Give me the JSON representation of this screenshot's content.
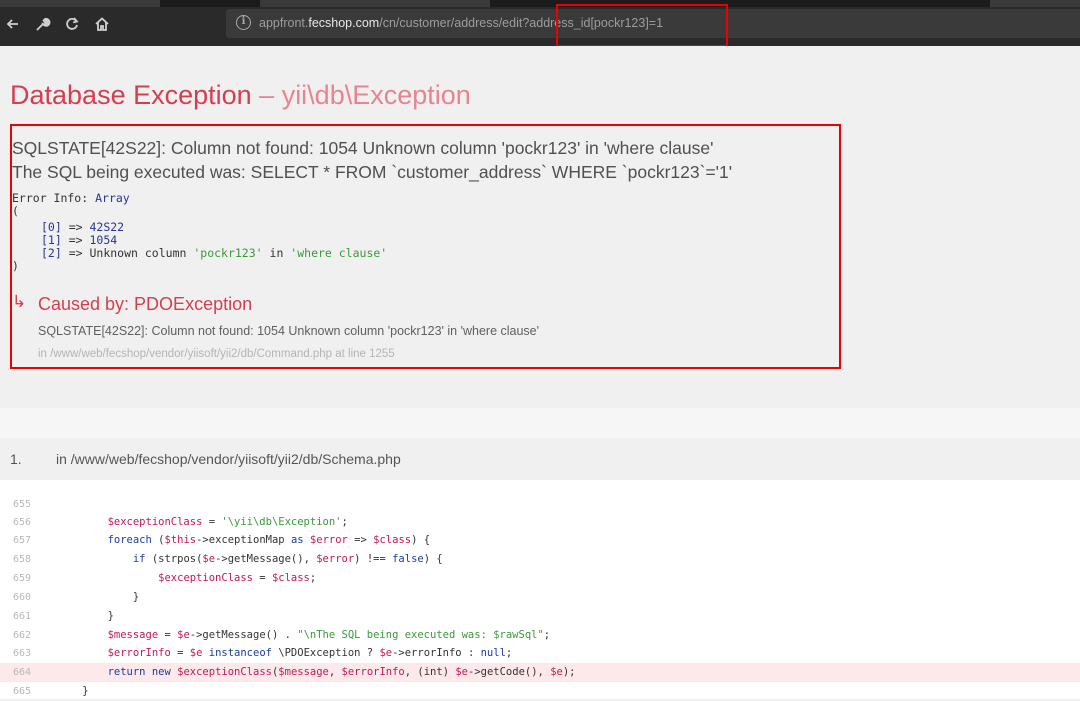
{
  "browser": {
    "url_host_prefix": "appfront.",
    "url_host_main": "fecshop.com",
    "url_path": "/cn/customer/address/edit?address_id[pockr123]=1",
    "icons": [
      "back-arrow-icon",
      "wrench-icon",
      "reload-icon",
      "home-icon",
      "info-icon"
    ]
  },
  "exception": {
    "title": "Database Exception",
    "title_separator": " – ",
    "title_class": "yii\\db\\Exception",
    "message_line1": "SQLSTATE[42S22]: Column not found: 1054 Unknown column 'pockr123' in 'where clause'",
    "message_line2": "The SQL being executed was: SELECT * FROM `customer_address` WHERE `pockr123`='1'",
    "error_info": {
      "label": "Error Info: ",
      "type": "Array",
      "open": "(",
      "close": ")",
      "rows": [
        {
          "key": "[0]",
          "arrow": " => ",
          "value": "42S22"
        },
        {
          "key": "[1]",
          "arrow": " => ",
          "value": "1054"
        },
        {
          "key": "[2]",
          "arrow": " => ",
          "value_pre": "Unknown column ",
          "value_str1": "'pockr123'",
          "value_mid": " in ",
          "value_str2": "'where clause'"
        }
      ]
    },
    "caused_by": {
      "label": "Caused by: PDOException",
      "message": "SQLSTATE[42S22]: Column not found: 1054 Unknown column 'pockr123' in 'where clause'",
      "location": "in /www/web/fecshop/vendor/yiisoft/yii2/db/Command.php at line 1255"
    }
  },
  "callstack": {
    "number": "1.",
    "file": "in /www/web/fecshop/vendor/yiisoft/yii2/db/Schema.php",
    "lines": [
      {
        "n": "655",
        "html_key": "l655"
      },
      {
        "n": "656",
        "html_key": "l656"
      },
      {
        "n": "657",
        "html_key": "l657"
      },
      {
        "n": "658",
        "html_key": "l658"
      },
      {
        "n": "659",
        "html_key": "l659"
      },
      {
        "n": "660",
        "html_key": "l660"
      },
      {
        "n": "661",
        "html_key": "l661"
      },
      {
        "n": "662",
        "html_key": "l662"
      },
      {
        "n": "663",
        "html_key": "l663"
      },
      {
        "n": "664",
        "html_key": "l664",
        "error": true
      },
      {
        "n": "665",
        "html_key": "l665"
      }
    ],
    "code": {
      "l656_var": "$exceptionClass",
      "l656_str": "'\\yii\\db\\Exception'",
      "l657_kw": "foreach",
      "l657_var1": "$this",
      "l657_prop": "->exceptionMap ",
      "l657_as": "as",
      "l657_var2": "$error",
      "l657_var3": "$class",
      "l658_kw": "if",
      "l658_fn": " (strpos(",
      "l658_var1": "$e",
      "l658_mid": "->getMessage(), ",
      "l658_var2": "$error",
      "l658_end": ") !== ",
      "l658_false": "false",
      "l658_close": ") {",
      "l659_var1": "$exceptionClass",
      "l659_var2": "$class",
      "l662_var1": "$message",
      "l662_var2": "$e",
      "l662_mid": "->getMessage() . ",
      "l662_str": "\"\\nThe SQL being executed was: $rawSql\"",
      "l663_var1": "$errorInfo",
      "l663_var2": "$e",
      "l663_inst": "instanceof",
      "l663_cls": " \\PDOException ? ",
      "l663_var3": "$e",
      "l663_end": "->errorInfo : ",
      "l663_null": "null",
      "l664_return": "return",
      "l664_new": "new",
      "l664_var1": "$exceptionClass",
      "l664_var2": "$message",
      "l664_var3": "$errorInfo",
      "l664_int": "(int) ",
      "l664_var4": "$e",
      "l664_mid": "->getCode(), ",
      "l664_var5": "$e"
    }
  }
}
